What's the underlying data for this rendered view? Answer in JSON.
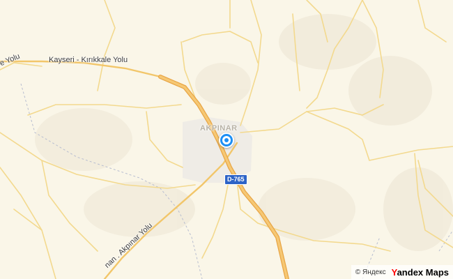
{
  "map": {
    "roads": {
      "kayseri_kirikkale": "Kayseri - Kırıkkale Yolu",
      "left_edge_fragment": "e Yolu",
      "akpinar_road": "nan . Akpınar Yolu"
    },
    "town": "AKPINAR",
    "route_shield": "D-765",
    "colors": {
      "land": "#faf6e8",
      "road_minor": "#f2d27a",
      "road_major": "#f0b35a",
      "marker": "#1d8ff5",
      "shield": "#2d63c7"
    }
  },
  "attribution": {
    "copyright": "© Яндекс",
    "brand_first": "Y",
    "brand_rest": "andex Maps"
  }
}
